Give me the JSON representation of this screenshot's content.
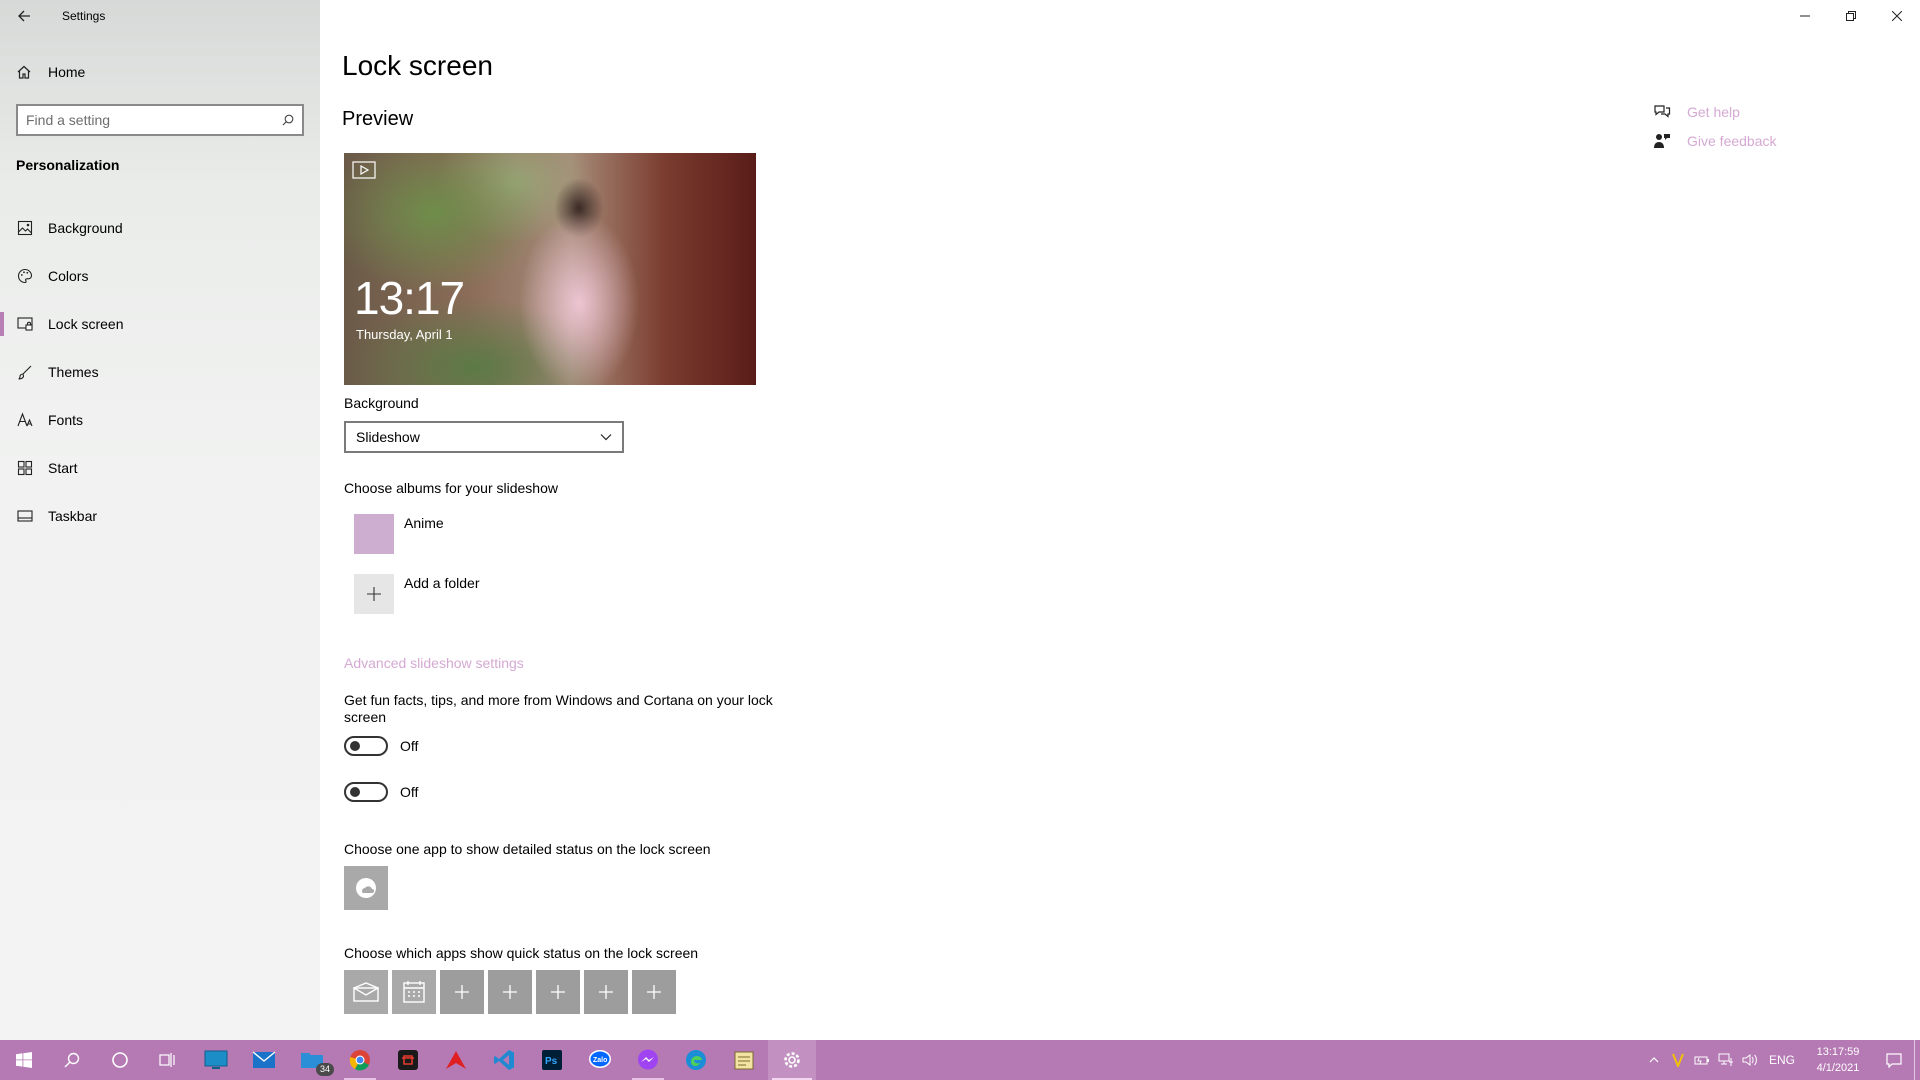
{
  "window": {
    "title": "Settings"
  },
  "sidebar": {
    "home_label": "Home",
    "search_placeholder": "Find a setting",
    "section": "Personalization",
    "items": [
      {
        "label": "Background",
        "icon": "image-icon"
      },
      {
        "label": "Colors",
        "icon": "palette-icon"
      },
      {
        "label": "Lock screen",
        "icon": "lock-screen-icon",
        "selected": true
      },
      {
        "label": "Themes",
        "icon": "brush-icon"
      },
      {
        "label": "Fonts",
        "icon": "font-icon"
      },
      {
        "label": "Start",
        "icon": "start-grid-icon"
      },
      {
        "label": "Taskbar",
        "icon": "taskbar-icon"
      }
    ]
  },
  "main": {
    "page_title": "Lock screen",
    "preview_label": "Preview",
    "preview_time": "13:17",
    "preview_date": "Thursday, April 1",
    "background_label": "Background",
    "background_value": "Slideshow",
    "albums_label": "Choose albums for your slideshow",
    "albums": [
      {
        "label": "Anime"
      }
    ],
    "add_folder_label": "Add a folder",
    "advanced_link": "Advanced slideshow settings",
    "fun_facts_label": "Get fun facts, tips, and more from Windows and Cortana on your lock screen",
    "toggle1_state": "Off",
    "toggle2_state": "Off",
    "detailed_status_label": "Choose one app to show detailed status on the lock screen",
    "quick_status_label": "Choose which apps show quick status on the lock screen",
    "get_help": "Get help",
    "give_feedback": "Give feedback"
  },
  "taskbar": {
    "mail_badge": "34",
    "lang": "ENG",
    "time": "13:17:59",
    "date": "4/1/2021"
  },
  "colors": {
    "accent": "#b77fb6",
    "taskbar": "#b579b4",
    "link": "#d5a9d3"
  }
}
